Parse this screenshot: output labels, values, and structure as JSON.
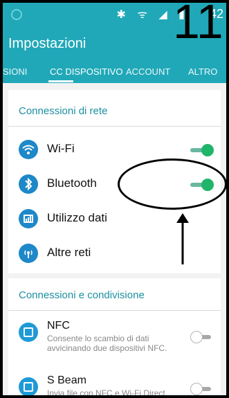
{
  "status_bar": {
    "icons": "✱ ᯤ ◢ ▮",
    "time": "42"
  },
  "overlay": {
    "number": "11"
  },
  "app_bar": {
    "title": "Impostazioni",
    "tabs": [
      {
        "label": "SIONI"
      },
      {
        "label": "CC DISPOSITIVO"
      },
      {
        "label": "ACCOUNT"
      },
      {
        "label": "ALTRO"
      }
    ]
  },
  "sections": [
    {
      "title": "Connessioni di rete",
      "items": [
        {
          "icon": "wifi-icon",
          "label": "Wi-Fi",
          "toggle": "on"
        },
        {
          "icon": "bluetooth-icon",
          "label": "Bluetooth",
          "toggle": "on"
        },
        {
          "icon": "data-usage-icon",
          "label": "Utilizzo dati"
        },
        {
          "icon": "other-networks-icon",
          "label": "Altre reti"
        }
      ]
    },
    {
      "title": "Connessioni e condivisione",
      "items": [
        {
          "icon": "nfc-icon",
          "label": "NFC",
          "subtitle": "Consente lo scambio di dati avvicinando due dispositivi NFC.",
          "toggle": "off"
        },
        {
          "icon": "s-beam-icon",
          "label": "S Beam",
          "subtitle": "Invia file con NFC e Wi-Fi Direct.",
          "toggle": "off"
        }
      ]
    }
  ],
  "colors": {
    "accent": "#20a8b8",
    "section_title": "#1b8fa0",
    "toggle_on": "#20b56a"
  }
}
